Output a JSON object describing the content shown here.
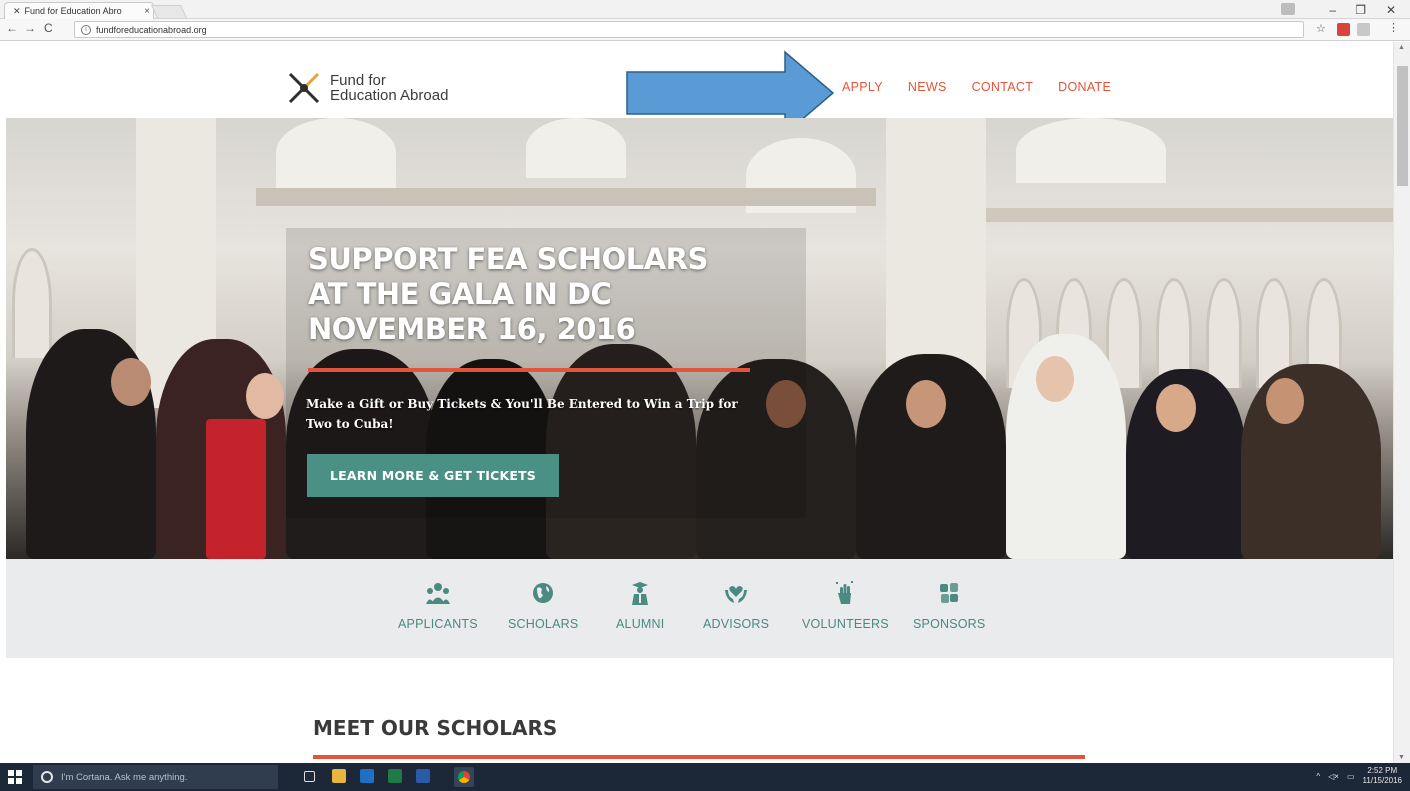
{
  "browser": {
    "tab_title": "Fund for Education Abro",
    "tab_favicon": "fea-logo-icon",
    "url": "fundforeducationabroad.org"
  },
  "site": {
    "logo_line1": "Fund for",
    "logo_line2": "Education Abroad",
    "menu": [
      "APPLY",
      "NEWS",
      "CONTACT",
      "DONATE"
    ]
  },
  "hero": {
    "title_line1": "SUPPORT FEA SCHOLARS",
    "title_line2": "AT THE GALA IN DC",
    "title_line3": "NOVEMBER 16, 2016",
    "subtitle": "Make a Gift or Buy Tickets & You'll Be Entered to Win a Trip for Two to Cuba!",
    "button": "LEARN MORE & GET TICKETS"
  },
  "audiences": [
    {
      "label": "APPLICANTS",
      "icon": "group-icon"
    },
    {
      "label": "SCHOLARS",
      "icon": "globe-icon"
    },
    {
      "label": "ALUMNI",
      "icon": "graduate-icon"
    },
    {
      "label": "ADVISORS",
      "icon": "hands-heart-icon"
    },
    {
      "label": "VOLUNTEERS",
      "icon": "raised-hand-icon"
    },
    {
      "label": "SPONSORS",
      "icon": "handshake-icon"
    }
  ],
  "meet": {
    "title": "MEET OUR SCHOLARS"
  },
  "taskbar": {
    "cortana_placeholder": "I'm Cortana. Ask me anything.",
    "time": "2:52 PM",
    "date": "11/15/2016"
  },
  "colors": {
    "accent": "#e2553a",
    "teal": "#4a9084",
    "band_bg": "#e9ebed",
    "annotation_arrow": "#5b9bd5"
  }
}
